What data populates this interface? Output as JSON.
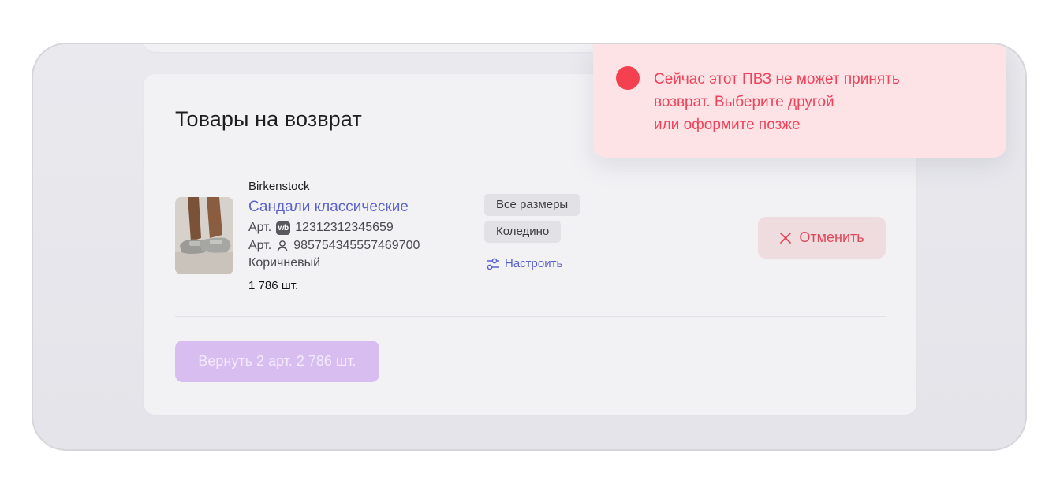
{
  "returns": {
    "title": "Товары на возврат",
    "item": {
      "brand": "Birkenstock",
      "name": "Сандали классические",
      "article_label": "Арт.",
      "wb_badge": "wb",
      "wb_article": "12312312345659",
      "seller_article": "985754345557469700",
      "color": "Коричневый",
      "quantity": "1 786 шт.",
      "tags": [
        "Все размеры",
        "Коледино"
      ],
      "configure_label": "Настроить",
      "cancel_label": "Отменить"
    },
    "submit_label": "Вернуть 2 арт. 2 786 шт."
  },
  "toast": {
    "lines": [
      "Сейчас этот ПВЗ не может принять",
      "возврат. Выберите другой",
      "или оформите позже"
    ]
  },
  "colors": {
    "accent": "#5b62c9",
    "error": "#f5414f",
    "submit_disabled": "#d8bdf0"
  },
  "icons": {
    "cancel": "close-icon",
    "configure": "settings-sliders-icon",
    "seller": "user-icon",
    "alert": "error-dot-icon"
  }
}
